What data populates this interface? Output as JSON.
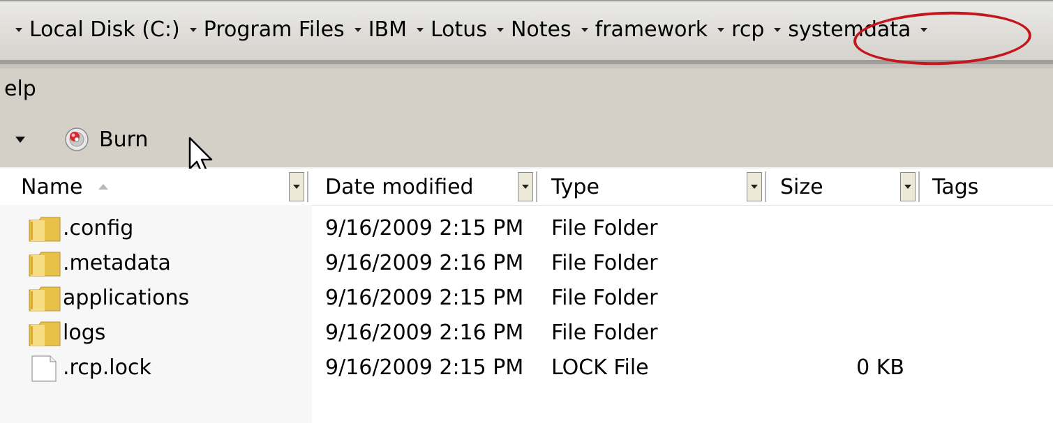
{
  "address_bar": {
    "crumbs": [
      "Local Disk (C:)",
      "Program Files",
      "IBM",
      "Lotus",
      "Notes",
      "framework",
      "rcp",
      "systemdata"
    ]
  },
  "menu": {
    "help_label": "elp"
  },
  "toolbar": {
    "burn_label": "Burn"
  },
  "columns": [
    {
      "label": "Name"
    },
    {
      "label": "Date modified"
    },
    {
      "label": "Type"
    },
    {
      "label": "Size"
    },
    {
      "label": "Tags"
    }
  ],
  "files": [
    {
      "name": ".config",
      "date": "9/16/2009 2:15 PM",
      "type": "File Folder",
      "size": "",
      "icon": "folder-icon"
    },
    {
      "name": ".metadata",
      "date": "9/16/2009 2:16 PM",
      "type": "File Folder",
      "size": "",
      "icon": "folder-icon"
    },
    {
      "name": "applications",
      "date": "9/16/2009 2:15 PM",
      "type": "File Folder",
      "size": "",
      "icon": "folder-icon"
    },
    {
      "name": "logs",
      "date": "9/16/2009 2:16 PM",
      "type": "File Folder",
      "size": "",
      "icon": "folder-icon"
    },
    {
      "name": ".rcp.lock",
      "date": "9/16/2009 2:15 PM",
      "type": "LOCK File",
      "size": "0 KB",
      "icon": "file-icon"
    }
  ],
  "colors": {
    "highlight_ellipse": "#c4161c",
    "chrome": "#d4d0c8",
    "folder": "#e8c14a"
  }
}
